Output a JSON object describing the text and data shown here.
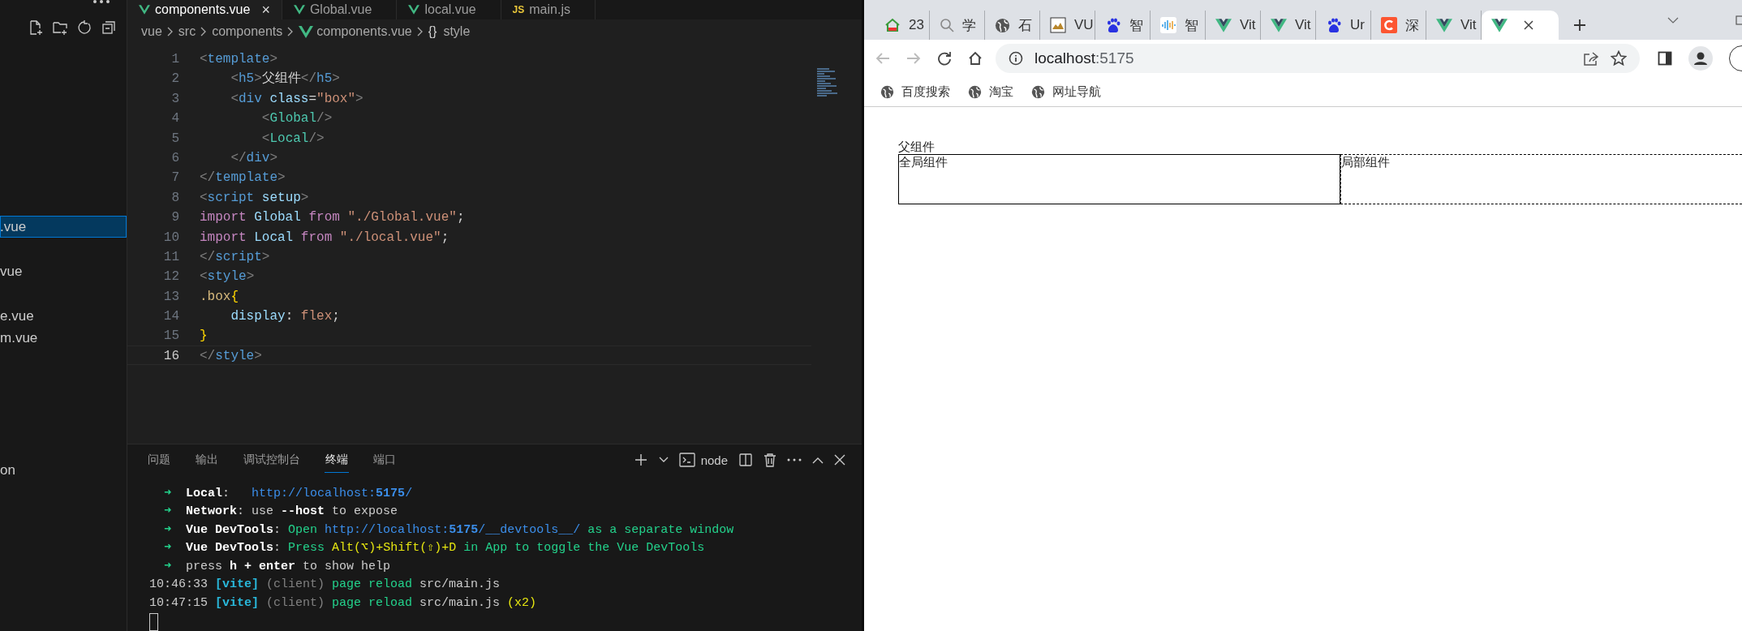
{
  "explorer": {
    "items": [
      {
        "label": ".vue",
        "selected": true
      },
      {
        "label": "vue",
        "selected": false
      },
      {
        "label": "e.vue",
        "selected": false
      },
      {
        "label": "m.vue",
        "selected": false
      },
      {
        "label": "on",
        "selected": false
      }
    ]
  },
  "editor": {
    "tabs": [
      {
        "label": "components.vue",
        "kind": "vue",
        "selected": true,
        "close": "×"
      },
      {
        "label": "Global.vue",
        "kind": "vue",
        "selected": false
      },
      {
        "label": "local.vue",
        "kind": "vue",
        "selected": false
      },
      {
        "label": "main.js",
        "kind": "js",
        "badge": "JS",
        "selected": false
      }
    ],
    "breadcrumb": [
      {
        "label": "vue",
        "kind": "plain"
      },
      {
        "label": "src",
        "kind": "plain"
      },
      {
        "label": "components",
        "kind": "plain"
      },
      {
        "label": "components.vue",
        "kind": "vue"
      },
      {
        "label": "style",
        "kind": "glyph",
        "glyph": "{}"
      }
    ],
    "lines": [
      {
        "number": "1",
        "current": false,
        "tokens": [
          {
            "kind": "b",
            "text": "<"
          },
          {
            "kind": "tag",
            "text": "template"
          },
          {
            "kind": "b",
            "text": ">"
          }
        ]
      },
      {
        "number": "2",
        "current": false,
        "tokens": [
          {
            "kind": "b",
            "text": "    <"
          },
          {
            "kind": "tag",
            "text": "h5"
          },
          {
            "kind": "b",
            "text": ">"
          },
          {
            "kind": "t",
            "text": "父组件"
          },
          {
            "kind": "b",
            "text": "</"
          },
          {
            "kind": "tag",
            "text": "h5"
          },
          {
            "kind": "b",
            "text": ">"
          }
        ]
      },
      {
        "number": "3",
        "current": false,
        "tokens": [
          {
            "kind": "b",
            "text": "    <"
          },
          {
            "kind": "tag",
            "text": "div"
          },
          {
            "kind": "attr",
            "text": " class"
          },
          {
            "kind": "t",
            "text": "="
          },
          {
            "kind": "str",
            "text": "\"box\""
          },
          {
            "kind": "b",
            "text": ">"
          }
        ]
      },
      {
        "number": "4",
        "current": false,
        "tokens": [
          {
            "kind": "b",
            "text": "        <"
          },
          {
            "kind": "cmp",
            "text": "Global"
          },
          {
            "kind": "b",
            "text": "/>"
          }
        ]
      },
      {
        "number": "5",
        "current": false,
        "tokens": [
          {
            "kind": "b",
            "text": "        <"
          },
          {
            "kind": "cmp",
            "text": "Local"
          },
          {
            "kind": "b",
            "text": "/>"
          }
        ]
      },
      {
        "number": "6",
        "current": false,
        "tokens": [
          {
            "kind": "b",
            "text": "    </"
          },
          {
            "kind": "tag",
            "text": "div"
          },
          {
            "kind": "b",
            "text": ">"
          }
        ]
      },
      {
        "number": "7",
        "current": false,
        "tokens": [
          {
            "kind": "b",
            "text": "</"
          },
          {
            "kind": "tag",
            "text": "template"
          },
          {
            "kind": "b",
            "text": ">"
          }
        ]
      },
      {
        "number": "8",
        "current": false,
        "tokens": [
          {
            "kind": "b",
            "text": "<"
          },
          {
            "kind": "tag",
            "text": "script"
          },
          {
            "kind": "attr",
            "text": " setup"
          },
          {
            "kind": "b",
            "text": ">"
          }
        ]
      },
      {
        "number": "9",
        "current": false,
        "tokens": [
          {
            "kind": "kw",
            "text": "import"
          },
          {
            "kind": "attr",
            "text": " Global"
          },
          {
            "kind": "kw",
            "text": " from"
          },
          {
            "kind": "str",
            "text": " \"./Global.vue\""
          },
          {
            "kind": "t",
            "text": ";"
          }
        ]
      },
      {
        "number": "10",
        "current": false,
        "tokens": [
          {
            "kind": "kw",
            "text": "import"
          },
          {
            "kind": "attr",
            "text": " Local"
          },
          {
            "kind": "kw",
            "text": " from"
          },
          {
            "kind": "str",
            "text": " \"./local.vue\""
          },
          {
            "kind": "t",
            "text": ";"
          }
        ]
      },
      {
        "number": "11",
        "current": false,
        "tokens": [
          {
            "kind": "b",
            "text": "</"
          },
          {
            "kind": "tag",
            "text": "script"
          },
          {
            "kind": "b",
            "text": ">"
          }
        ]
      },
      {
        "number": "12",
        "current": false,
        "tokens": [
          {
            "kind": "b",
            "text": "<"
          },
          {
            "kind": "tag",
            "text": "style"
          },
          {
            "kind": "b",
            "text": ">"
          }
        ]
      },
      {
        "number": "13",
        "current": false,
        "tokens": [
          {
            "kind": "sel",
            "text": ".box"
          },
          {
            "kind": "br",
            "text": "{"
          }
        ]
      },
      {
        "number": "14",
        "current": false,
        "tokens": [
          {
            "kind": "attr",
            "text": "    display"
          },
          {
            "kind": "t",
            "text": ": "
          },
          {
            "kind": "str",
            "text": "flex"
          },
          {
            "kind": "t",
            "text": ";"
          }
        ]
      },
      {
        "number": "15",
        "current": false,
        "tokens": [
          {
            "kind": "br",
            "text": "}"
          }
        ]
      },
      {
        "number": "16",
        "current": true,
        "tokens": [
          {
            "kind": "b",
            "text": "</"
          },
          {
            "kind": "tag",
            "text": "style"
          },
          {
            "kind": "b",
            "text": ">"
          }
        ]
      }
    ]
  },
  "panel": {
    "tabs": [
      {
        "label": "问题",
        "selected": false
      },
      {
        "label": "输出",
        "selected": false
      },
      {
        "label": "调试控制台",
        "selected": false
      },
      {
        "label": "终端",
        "selected": true
      },
      {
        "label": "端口",
        "selected": false
      }
    ],
    "shell": "node",
    "lines": [
      [
        {
          "kind": "arrow",
          "text": "  ➜"
        },
        {
          "kind": "bw",
          "text": "  Local"
        },
        {
          "kind": "t",
          "text": ":   "
        },
        {
          "kind": "url",
          "text": "http://localhost:"
        },
        {
          "kind": "urlb",
          "text": "5175"
        },
        {
          "kind": "url",
          "text": "/"
        }
      ],
      [
        {
          "kind": "arrow",
          "text": "  ➜"
        },
        {
          "kind": "bw",
          "text": "  Network"
        },
        {
          "kind": "t",
          "text": ": use "
        },
        {
          "kind": "bw",
          "text": "--host"
        },
        {
          "kind": "t",
          "text": " to expose"
        }
      ],
      [
        {
          "kind": "arrow",
          "text": "  ➜"
        },
        {
          "kind": "bw",
          "text": "  Vue DevTools"
        },
        {
          "kind": "t",
          "text": ": "
        },
        {
          "kind": "g",
          "text": "Open "
        },
        {
          "kind": "url",
          "text": "http://localhost:"
        },
        {
          "kind": "urlb",
          "text": "5175"
        },
        {
          "kind": "url",
          "text": "/__devtools__/"
        },
        {
          "kind": "g",
          "text": " as a separate window"
        }
      ],
      [
        {
          "kind": "arrow",
          "text": "  ➜"
        },
        {
          "kind": "bw",
          "text": "  Vue DevTools"
        },
        {
          "kind": "t",
          "text": ": "
        },
        {
          "kind": "g",
          "text": "Press "
        },
        {
          "kind": "y",
          "text": "Alt(⌥)+Shift(⇧)+D"
        },
        {
          "kind": "g",
          "text": " in App to toggle the Vue DevTools"
        }
      ],
      [
        {
          "kind": "arrow",
          "text": "  ➜"
        },
        {
          "kind": "t",
          "text": "  press "
        },
        {
          "kind": "bw",
          "text": "h + enter"
        },
        {
          "kind": "t",
          "text": " to show help"
        }
      ],
      [
        {
          "kind": "t",
          "text": "10:46:33 "
        },
        {
          "kind": "cy",
          "text": "[vite]"
        },
        {
          "kind": "gray",
          "text": " (client)"
        },
        {
          "kind": "g",
          "text": " page reload"
        },
        {
          "kind": "t",
          "text": " src/main.js"
        }
      ],
      [
        {
          "kind": "t",
          "text": "10:47:15 "
        },
        {
          "kind": "cy",
          "text": "[vite]"
        },
        {
          "kind": "gray",
          "text": " (client)"
        },
        {
          "kind": "g",
          "text": " page reload"
        },
        {
          "kind": "t",
          "text": " src/main.js"
        },
        {
          "kind": "y",
          "text": " (x2)"
        }
      ]
    ]
  },
  "browser": {
    "tabs": [
      {
        "label": "23",
        "kind": "house",
        "selected": false
      },
      {
        "label": "学",
        "kind": "search",
        "selected": false
      },
      {
        "label": "石",
        "kind": "globe",
        "selected": false
      },
      {
        "label": "VU",
        "kind": "picture",
        "selected": false
      },
      {
        "label": "智",
        "kind": "paw",
        "selected": false
      },
      {
        "label": "智",
        "kind": "bars",
        "selected": false
      },
      {
        "label": "Vit",
        "kind": "vue",
        "selected": false
      },
      {
        "label": "Vit",
        "kind": "vue",
        "selected": false
      },
      {
        "label": "Ur",
        "kind": "paw",
        "selected": false
      },
      {
        "label": "深",
        "kind": "letter",
        "selected": false
      },
      {
        "label": "Vit",
        "kind": "vue",
        "selected": false
      },
      {
        "kind": "vue",
        "selected": true
      }
    ],
    "address": {
      "host": "localhost",
      "port": ":5175"
    },
    "bookmarks": [
      "百度搜索",
      "淘宝",
      "网址导航"
    ],
    "page": {
      "heading": "父组件",
      "boxes": [
        {
          "label": "全局组件",
          "kind": "solid"
        },
        {
          "label": "局部组件",
          "kind": "dashed"
        }
      ]
    }
  }
}
